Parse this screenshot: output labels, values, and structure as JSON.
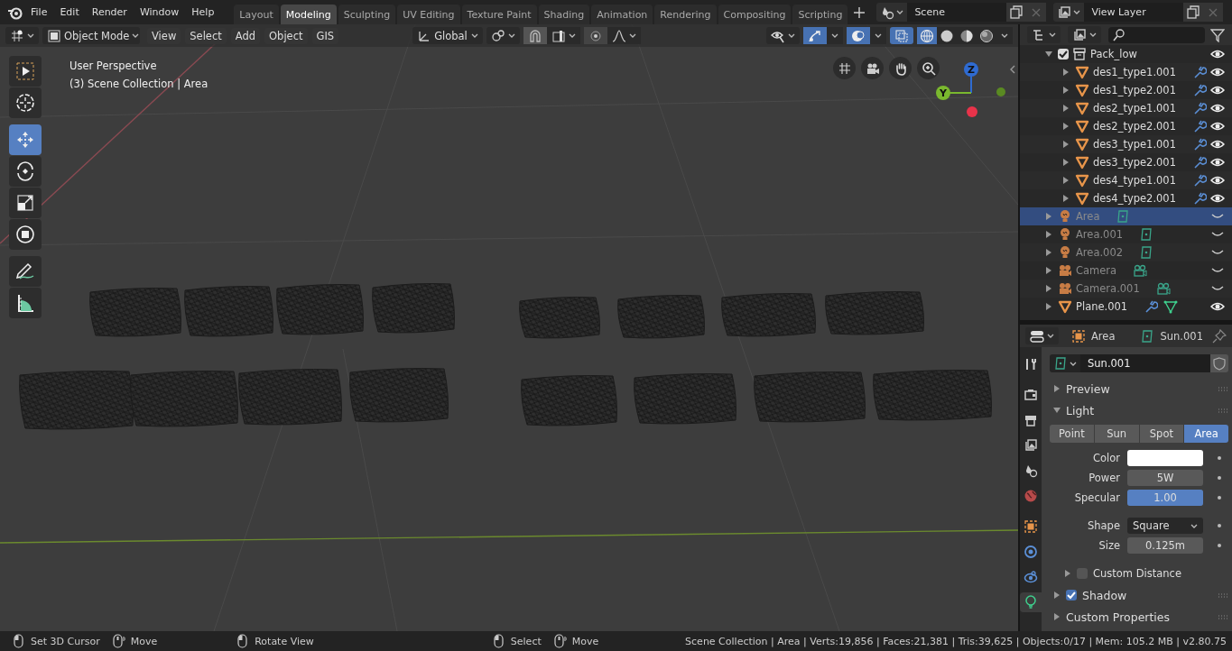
{
  "menu_bar": [
    "File",
    "Edit",
    "Render",
    "Window",
    "Help"
  ],
  "workspaces": [
    {
      "label": "Layout",
      "selected": false
    },
    {
      "label": "Modeling",
      "selected": true
    },
    {
      "label": "Sculpting",
      "selected": false
    },
    {
      "label": "UV Editing",
      "selected": false
    },
    {
      "label": "Texture Paint",
      "selected": false
    },
    {
      "label": "Shading",
      "selected": false
    },
    {
      "label": "Animation",
      "selected": false
    },
    {
      "label": "Rendering",
      "selected": false
    },
    {
      "label": "Compositing",
      "selected": false
    },
    {
      "label": "Scripting",
      "selected": false
    }
  ],
  "scene": "Scene",
  "view_layer": "View Layer",
  "viewport": {
    "header": {
      "mode": "Object Mode",
      "menus": [
        "View",
        "Select",
        "Add",
        "Object",
        "GIS"
      ],
      "orientation": "Global",
      "gizmos": true,
      "overlays": true,
      "xray": true,
      "shading": [
        {
          "selected": true
        },
        {
          "selected": false
        },
        {
          "selected": false
        },
        {
          "selected": false
        }
      ]
    },
    "info": [
      "User Perspective",
      "(3) Scene Collection | Area"
    ],
    "tools": [
      {
        "kind": "select",
        "selected": false
      },
      {
        "kind": "cursor",
        "selected": false
      },
      {
        "kind": "move",
        "selected": true
      },
      {
        "kind": "rotate",
        "selected": false
      },
      {
        "kind": "scale",
        "selected": false
      },
      {
        "kind": "transform",
        "selected": false
      },
      {
        "kind": "annotate",
        "selected": false
      },
      {
        "kind": "measure",
        "selected": false
      }
    ],
    "gizmo_axes": [
      "Z",
      "Y"
    ]
  },
  "outliner": {
    "items": [
      {
        "name": "Pack_low",
        "kind": "collection",
        "checked": true,
        "expanded": true,
        "selected": false,
        "visible": true,
        "children": [
          {
            "name": "des1_type1.001",
            "kind": "mesh",
            "expanded": false,
            "selected": false,
            "visible": true,
            "modifier": true
          },
          {
            "name": "des1_type2.001",
            "kind": "mesh",
            "expanded": false,
            "selected": false,
            "visible": true,
            "modifier": true
          },
          {
            "name": "des2_type1.001",
            "kind": "mesh",
            "expanded": false,
            "selected": false,
            "visible": true,
            "modifier": true
          },
          {
            "name": "des2_type2.001",
            "kind": "mesh",
            "expanded": false,
            "selected": false,
            "visible": true,
            "modifier": true
          },
          {
            "name": "des3_type1.001",
            "kind": "mesh",
            "expanded": false,
            "selected": false,
            "visible": true,
            "modifier": true
          },
          {
            "name": "des3_type2.001",
            "kind": "mesh",
            "expanded": false,
            "selected": false,
            "visible": true,
            "modifier": true
          },
          {
            "name": "des4_type1.001",
            "kind": "mesh",
            "expanded": false,
            "selected": false,
            "visible": true,
            "modifier": true
          },
          {
            "name": "des4_type2.001",
            "kind": "mesh",
            "expanded": false,
            "selected": false,
            "visible": true,
            "modifier": true
          }
        ]
      },
      {
        "name": "Area",
        "kind": "light",
        "object_data": true,
        "expanded": false,
        "selected": true,
        "visible": false
      },
      {
        "name": "Area.001",
        "kind": "light",
        "object_data": true,
        "expanded": false,
        "selected": false,
        "visible": false
      },
      {
        "name": "Area.002",
        "kind": "light",
        "object_data": true,
        "expanded": false,
        "selected": false,
        "visible": false
      },
      {
        "name": "Camera",
        "kind": "camera",
        "object_data": true,
        "expanded": false,
        "selected": false,
        "visible": false
      },
      {
        "name": "Camera.001",
        "kind": "camera",
        "object_data": true,
        "expanded": false,
        "selected": false,
        "visible": false
      },
      {
        "name": "Plane.001",
        "kind": "mesh",
        "object_data": true,
        "expanded": false,
        "selected": false,
        "visible": true,
        "modifier": true
      }
    ]
  },
  "properties": {
    "context": {
      "object": "Area",
      "data": "Sun.001"
    },
    "tabs": [
      {
        "kind": "tool",
        "selected": false
      },
      {
        "kind": "render",
        "selected": false
      },
      {
        "kind": "output",
        "selected": false
      },
      {
        "kind": "view_layer",
        "selected": false
      },
      {
        "kind": "scene",
        "selected": false
      },
      {
        "kind": "world",
        "selected": false
      },
      {
        "kind": "object",
        "selected": false
      },
      {
        "kind": "physics",
        "selected": false
      },
      {
        "kind": "constraints",
        "selected": false
      },
      {
        "kind": "data",
        "selected": true
      }
    ],
    "datablock": "Sun.001",
    "panels": [
      {
        "title": "Preview",
        "expanded": false
      },
      {
        "title": "Light",
        "expanded": true,
        "light_types": [
          {
            "label": "Point",
            "selected": false
          },
          {
            "label": "Sun",
            "selected": false
          },
          {
            "label": "Spot",
            "selected": false
          },
          {
            "label": "Area",
            "selected": true
          }
        ],
        "fields": [
          {
            "kind": "color",
            "label": "Color",
            "color": "#ffffff"
          },
          {
            "kind": "number",
            "label": "Power",
            "value": "5W"
          },
          {
            "kind": "slider",
            "label": "Specular",
            "value": "1.00",
            "level": 1
          },
          {
            "kind": "dropdown",
            "label": "Shape",
            "value": "Square"
          },
          {
            "kind": "number",
            "label": "Size",
            "value": "0.125m"
          }
        ],
        "subpanels": [
          {
            "title": "Custom Distance",
            "checked": false,
            "expanded": false
          }
        ]
      },
      {
        "title": "Shadow",
        "checked": true,
        "expanded": false
      },
      {
        "title": "Custom Properties",
        "expanded": false
      }
    ]
  },
  "status_bar": {
    "hints": [
      {
        "kind": "click",
        "label": "Set 3D Cursor"
      },
      {
        "kind": "drag",
        "label": "Move"
      },
      {
        "kind": "click",
        "label": "Rotate View"
      },
      {
        "kind": "click",
        "label": "Select"
      },
      {
        "kind": "drag",
        "label": "Move"
      }
    ],
    "stats": "Scene Collection | Area | Verts:19,856 | Faces:21,381 | Tris:39,625 | Objects:0/17 | Mem: 105.2 MB | v2.80.75"
  }
}
